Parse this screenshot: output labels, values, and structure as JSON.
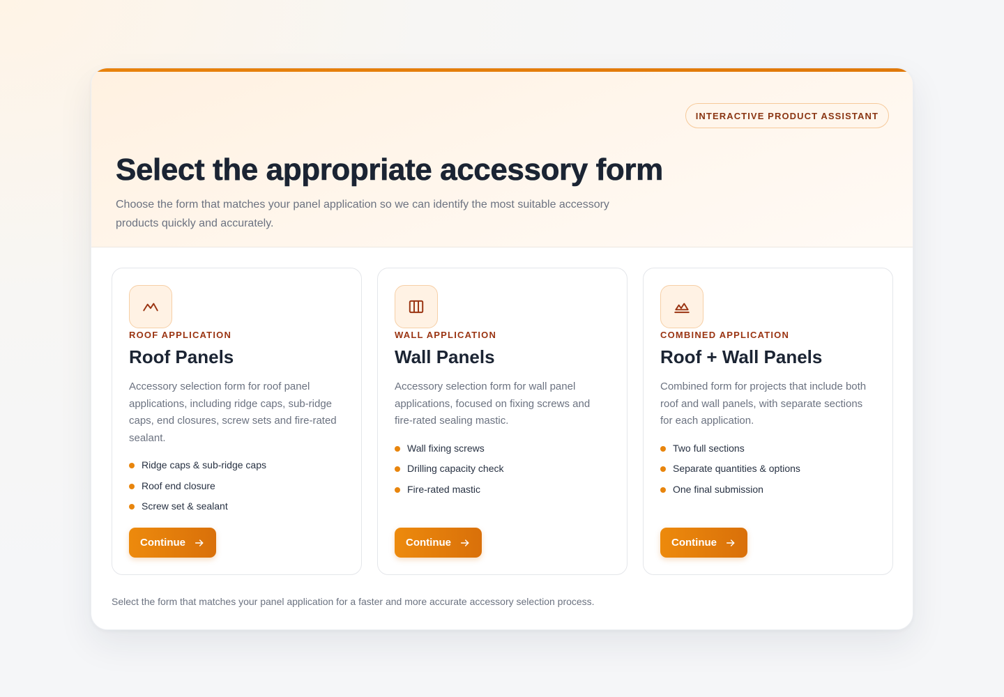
{
  "hero": {
    "badge": "INTERACTIVE PRODUCT ASSISTANT",
    "title": "Select the appropriate accessory form",
    "subtitle": "Choose the form that matches your panel application so we can identify the most suitable accessory products quickly and accurately."
  },
  "colors": {
    "accent": "#e8820c",
    "eyebrow": "#9a3412",
    "heading": "#1b2433"
  },
  "cards": [
    {
      "icon": "mountain-icon",
      "eyebrow": "ROOF APPLICATION",
      "title": "Roof Panels",
      "description": "Accessory selection form for roof panel applications, including ridge caps, sub-ridge caps, end closures, screw sets and fire-rated sealant.",
      "bullets": [
        "Ridge caps & sub-ridge caps",
        "Roof end closure",
        "Screw set & sealant"
      ],
      "button": "Continue"
    },
    {
      "icon": "columns-icon",
      "eyebrow": "WALL APPLICATION",
      "title": "Wall Panels",
      "description": "Accessory selection form for wall panel applications, focused on fixing screws and fire-rated sealing mastic.",
      "bullets": [
        "Wall fixing screws",
        "Drilling capacity check",
        "Fire-rated mastic"
      ],
      "button": "Continue"
    },
    {
      "icon": "roof-wall-icon",
      "eyebrow": "COMBINED APPLICATION",
      "title": "Roof + Wall Panels",
      "description": "Combined form for projects that include both roof and wall panels, with separate sections for each application.",
      "bullets": [
        "Two full sections",
        "Separate quantities & options",
        "One final submission"
      ],
      "button": "Continue"
    }
  ],
  "footer": {
    "note": "Select the form that matches your panel application for a faster and more accurate accessory selection process."
  }
}
